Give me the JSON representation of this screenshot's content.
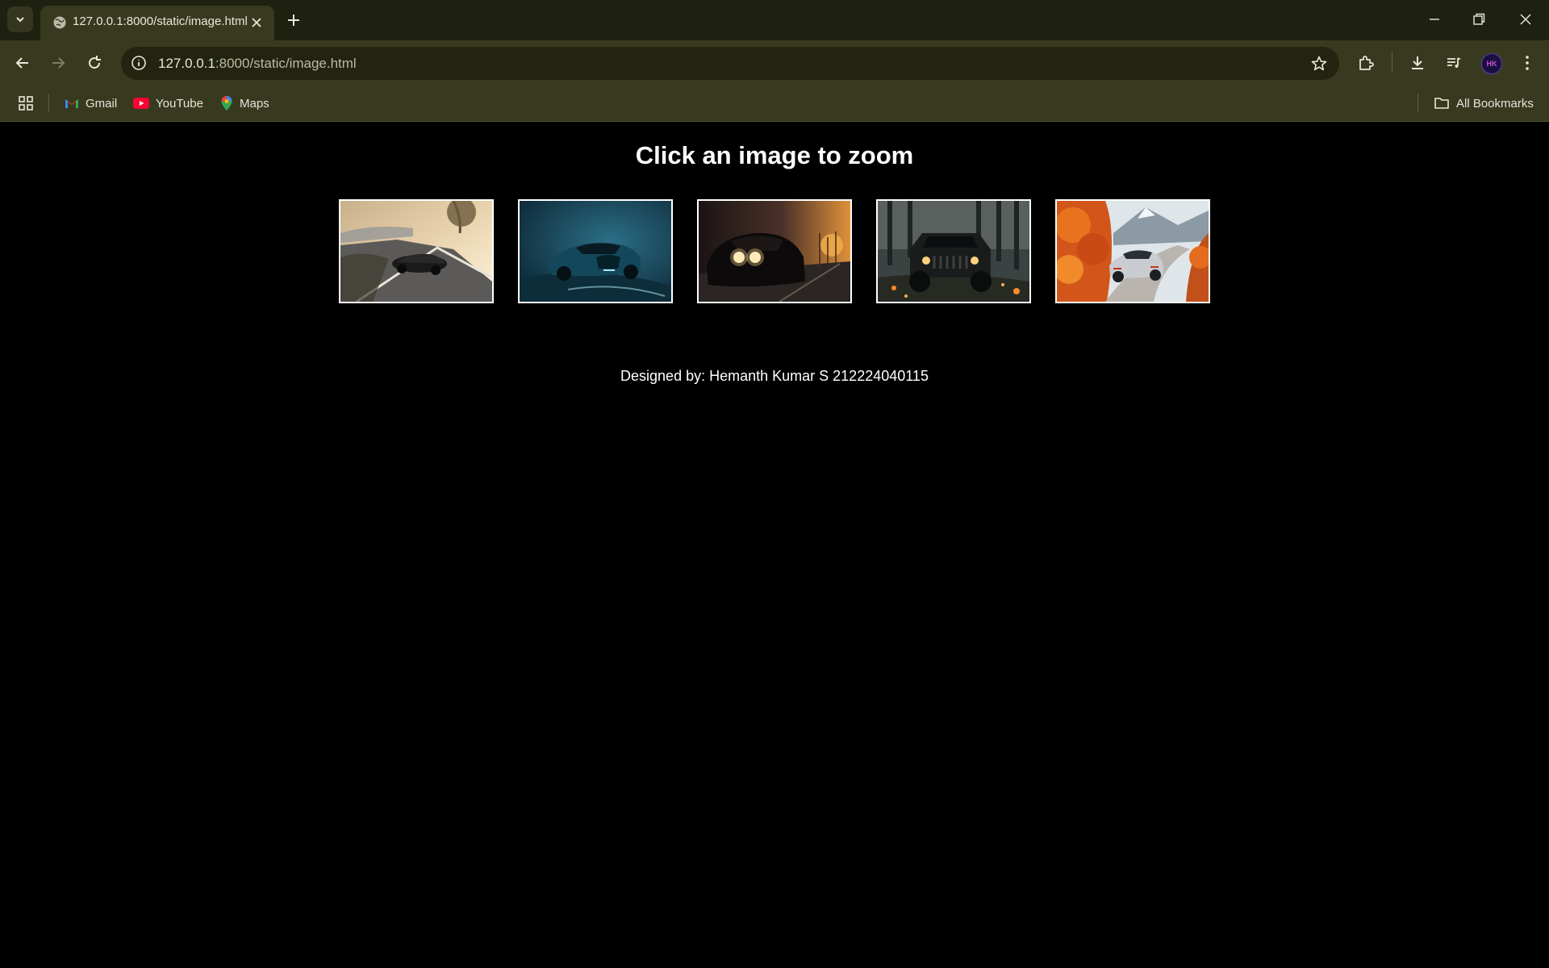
{
  "browser": {
    "tab_title": "127.0.0.1:8000/static/image.html",
    "url_host": "127.0.0.1",
    "url_rest": ":8000/static/image.html",
    "bookmarks": [
      {
        "label": "Gmail",
        "icon": "gmail-icon"
      },
      {
        "label": "YouTube",
        "icon": "youtube-icon"
      },
      {
        "label": "Maps",
        "icon": "maps-icon"
      }
    ],
    "all_bookmarks_label": "All Bookmarks",
    "profile_initials": "HK"
  },
  "page": {
    "heading": "Click an image to zoom",
    "images": [
      {
        "name": "convertible-coastal-road"
      },
      {
        "name": "teal-hypercar"
      },
      {
        "name": "muscle-car-sunset"
      },
      {
        "name": "jeep-forest"
      },
      {
        "name": "silver-sportscar-autumn"
      }
    ],
    "footer": "Designed by: Hemanth Kumar S 212224040115"
  }
}
